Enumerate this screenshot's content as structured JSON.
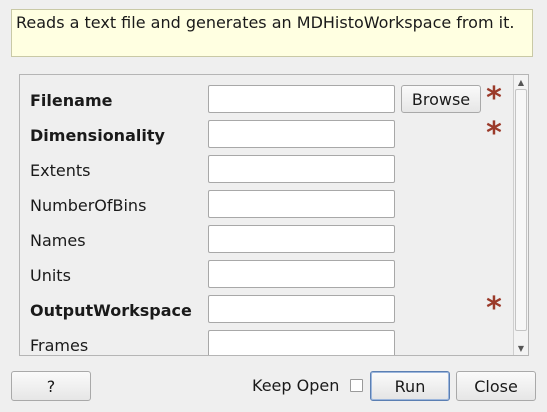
{
  "dialog": {
    "description": "Reads a text file and generates an MDHistoWorkspace from it."
  },
  "properties": [
    {
      "label": "Filename",
      "value": "",
      "required": true,
      "bold": true,
      "has_browse": true
    },
    {
      "label": "Dimensionality",
      "value": "",
      "required": true,
      "bold": true,
      "has_browse": false
    },
    {
      "label": "Extents",
      "value": "",
      "required": false,
      "bold": false,
      "has_browse": false
    },
    {
      "label": "NumberOfBins",
      "value": "",
      "required": false,
      "bold": false,
      "has_browse": false
    },
    {
      "label": "Names",
      "value": "",
      "required": false,
      "bold": false,
      "has_browse": false
    },
    {
      "label": "Units",
      "value": "",
      "required": false,
      "bold": false,
      "has_browse": false
    },
    {
      "label": "OutputWorkspace",
      "value": "",
      "required": true,
      "bold": true,
      "has_browse": false
    },
    {
      "label": "Frames",
      "value": "",
      "required": false,
      "bold": false,
      "has_browse": false
    }
  ],
  "browse_label": "Browse",
  "required_marker": "*",
  "required_color": "#9b3a2a",
  "icons": {
    "required": "asterisk-icon",
    "scroll_up": "arrow-up-icon",
    "scroll_down": "arrow-down-icon"
  },
  "footer": {
    "help_label": "?",
    "keep_open_label": "Keep Open",
    "keep_open_checked": false,
    "run_label": "Run",
    "close_label": "Close"
  }
}
